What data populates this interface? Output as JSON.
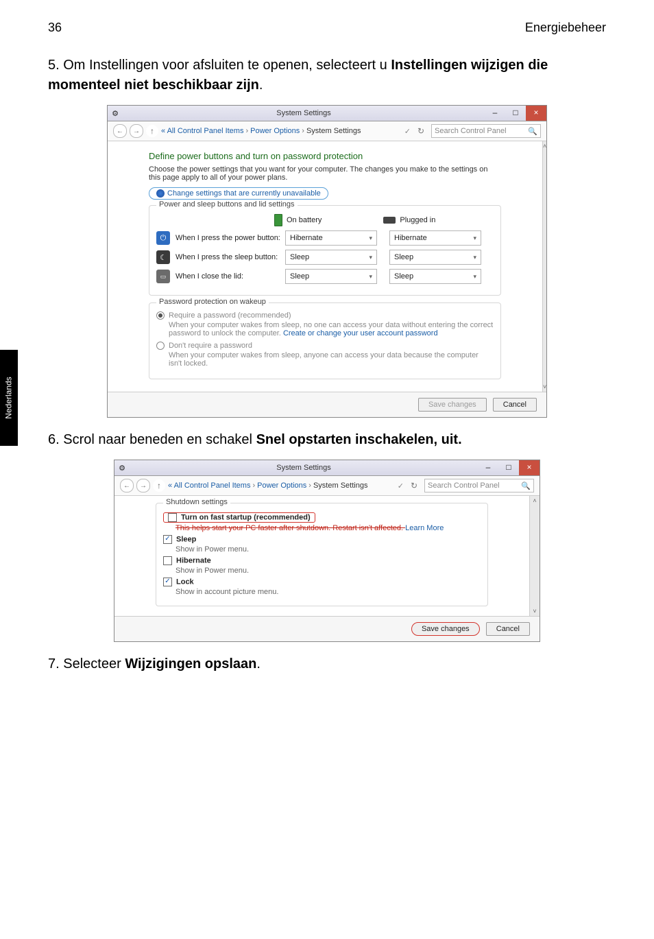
{
  "header": {
    "page_no": "36",
    "chapter": "Energiebeheer"
  },
  "side_tab": "Nederlands",
  "steps": {
    "s5_num": "5. ",
    "s5_a": "Om Instellingen voor afsluiten te openen, selecteert u ",
    "s5_b": "Instellingen wijzigen die momenteel niet beschikbaar zijn",
    "s5_c": ".",
    "s6_num": "6. ",
    "s6_a": "Scrol naar beneden en schakel  ",
    "s6_b": "Snel opstarten inschakelen, uit.",
    "s7_num": "7. ",
    "s7_a": "Selecteer ",
    "s7_b": "Wijzigingen opslaan",
    "s7_c": "."
  },
  "dlg": {
    "title": "System Settings",
    "crumb_a": "All Control Panel Items",
    "crumb_b": "Power Options",
    "crumb_c": "System Settings",
    "search_placeholder": "Search Control Panel",
    "heading": "Define power buttons and turn on password protection",
    "para": "Choose the power settings that you want for your computer. The changes you make to the settings on this page apply to all of your power plans.",
    "change_link": "Change settings that are currently unavailable",
    "group1": "Power and sleep buttons and lid settings",
    "col_batt": "On battery",
    "col_plug": "Plugged in",
    "row_power": "When I press the power button:",
    "row_sleep": "When I press the sleep button:",
    "row_lid": "When I close the lid:",
    "v_hib": "Hibernate",
    "v_sleep": "Sleep",
    "group2": "Password protection on wakeup",
    "r1": "Require a password (recommended)",
    "r1_text_a": "When your computer wakes from sleep, no one can access your data without entering the correct password to unlock the computer. ",
    "r1_link": "Create or change your user account password",
    "r2": "Don't require a password",
    "r2_text": "When your computer wakes from sleep, anyone can access your data because the computer isn't locked.",
    "save": "Save changes",
    "cancel": "Cancel"
  },
  "dlg2": {
    "group": "Shutdown settings",
    "fast": "Turn on fast startup (recommended)",
    "fast_sub_a": "This helps start your PC faster after shutdown. Restart isn't affected. ",
    "fast_sub_link": "Learn More",
    "sleep": "Sleep",
    "sleep_sub": "Show in Power menu.",
    "hib": "Hibernate",
    "hib_sub": "Show in Power menu.",
    "lock": "Lock",
    "lock_sub": "Show in account picture menu."
  }
}
